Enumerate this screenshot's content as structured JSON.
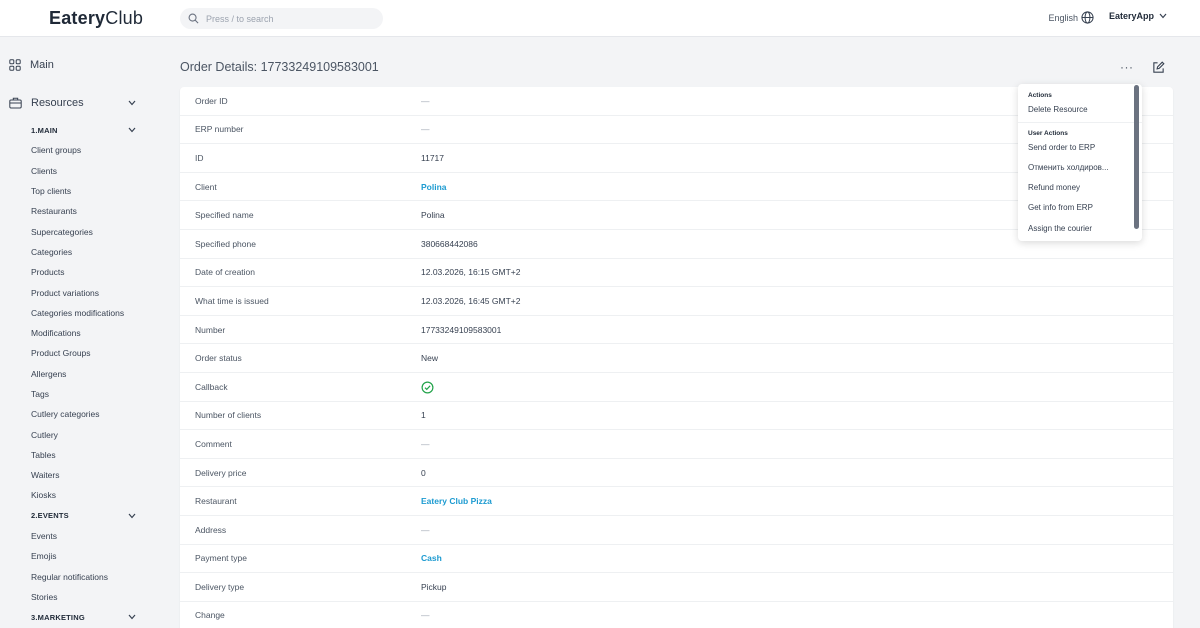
{
  "header": {
    "logo_bold": "Eatery",
    "logo_light": "Club",
    "search_placeholder": "Press / to search",
    "language": "English",
    "app_menu": "EateryApp"
  },
  "sidebar": {
    "main_label": "Main",
    "resources_label": "Resources",
    "items": [
      {
        "label": "1.MAIN",
        "group": true
      },
      {
        "label": "Client groups"
      },
      {
        "label": "Clients"
      },
      {
        "label": "Top clients"
      },
      {
        "label": "Restaurants"
      },
      {
        "label": "Supercategories"
      },
      {
        "label": "Categories"
      },
      {
        "label": "Products"
      },
      {
        "label": "Product variations"
      },
      {
        "label": "Categories modifications"
      },
      {
        "label": "Modifications"
      },
      {
        "label": "Product Groups"
      },
      {
        "label": "Allergens"
      },
      {
        "label": "Tags"
      },
      {
        "label": "Cutlery categories"
      },
      {
        "label": "Cutlery"
      },
      {
        "label": "Tables"
      },
      {
        "label": "Waiters"
      },
      {
        "label": "Kiosks"
      },
      {
        "label": "2.EVENTS",
        "group": true
      },
      {
        "label": "Events"
      },
      {
        "label": "Emojis"
      },
      {
        "label": "Regular notifications"
      },
      {
        "label": "Stories"
      },
      {
        "label": "3.MARKETING",
        "group": true
      }
    ]
  },
  "page": {
    "title": "Order Details: 17733249109583001",
    "more_label": "···"
  },
  "fields": [
    {
      "label": "Order ID",
      "value": "—",
      "kind": "dash"
    },
    {
      "label": "ERP number",
      "value": "—",
      "kind": "dash"
    },
    {
      "label": "ID",
      "value": "11717",
      "kind": "text"
    },
    {
      "label": "Client",
      "value": "Polina",
      "kind": "link"
    },
    {
      "label": "Specified name",
      "value": "Polina",
      "kind": "text"
    },
    {
      "label": "Specified phone",
      "value": "380668442086",
      "kind": "text"
    },
    {
      "label": "Date of creation",
      "value": "12.03.2026, 16:15 GMT+2",
      "kind": "text"
    },
    {
      "label": "What time is issued",
      "value": "12.03.2026, 16:45 GMT+2",
      "kind": "text"
    },
    {
      "label": "Number",
      "value": "17733249109583001",
      "kind": "text"
    },
    {
      "label": "Order status",
      "value": "New",
      "kind": "text"
    },
    {
      "label": "Callback",
      "value": "",
      "kind": "check"
    },
    {
      "label": "Number of clients",
      "value": "1",
      "kind": "text"
    },
    {
      "label": "Comment",
      "value": "—",
      "kind": "dash"
    },
    {
      "label": "Delivery price",
      "value": "0",
      "kind": "text"
    },
    {
      "label": "Restaurant",
      "value": "Eatery Club Pizza",
      "kind": "link"
    },
    {
      "label": "Address",
      "value": "—",
      "kind": "dash"
    },
    {
      "label": "Payment type",
      "value": "Cash",
      "kind": "link"
    },
    {
      "label": "Delivery type",
      "value": "Pickup",
      "kind": "text"
    },
    {
      "label": "Change",
      "value": "—",
      "kind": "dash"
    }
  ],
  "dropdown": {
    "actions_header": "Actions",
    "actions": [
      "Delete Resource"
    ],
    "user_actions_header": "User Actions",
    "user_actions": [
      "Send order to ERP",
      "Отменить холдиров...",
      "Refund money",
      "Get info from ERP",
      "Assign the courier"
    ]
  },
  "colors": {
    "link": "#1d9bd1",
    "check": "#22a34a",
    "background": "#f3f4f6"
  }
}
